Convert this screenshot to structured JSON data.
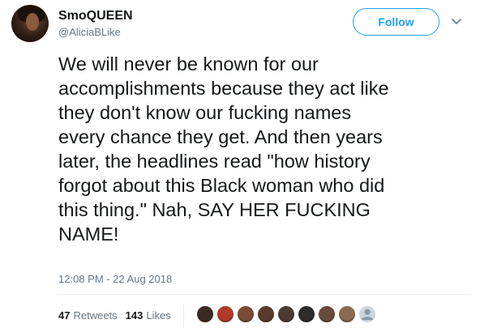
{
  "tweet": {
    "display_name": "SmoQUEEN",
    "handle": "@AliciaBLike",
    "follow_label": "Follow",
    "text": "We will never be known for our\naccomplishments because they act like\nthey don't know our fucking names\nevery chance they get. And then years\nlater, the headlines read \"how history\nforgot about this Black woman who did\nthis thing.\" Nah, SAY HER FUCKING\nNAME!",
    "timestamp": "12:08 PM - 22 Aug 2018",
    "retweets_count": "47",
    "retweets_label": "Retweets",
    "likes_count": "143",
    "likes_label": "Likes"
  },
  "icons": {
    "avatar": "user-avatar",
    "caret": "chevron-down-icon"
  },
  "colors": {
    "accent": "#1da1f2",
    "text_primary": "#14171a",
    "text_secondary": "#657786",
    "divider": "#e6ecf0"
  },
  "likers": [
    {
      "color": "#3b2a22"
    },
    {
      "color": "#b23a2a"
    },
    {
      "color": "#7a4a35"
    },
    {
      "color": "#5a3a2c"
    },
    {
      "color": "#4a3b33"
    },
    {
      "color": "#2c2c2c"
    },
    {
      "color": "#6a4b3a"
    },
    {
      "color": "#8a6a50"
    },
    {
      "color": "#ccd6dd"
    }
  ]
}
